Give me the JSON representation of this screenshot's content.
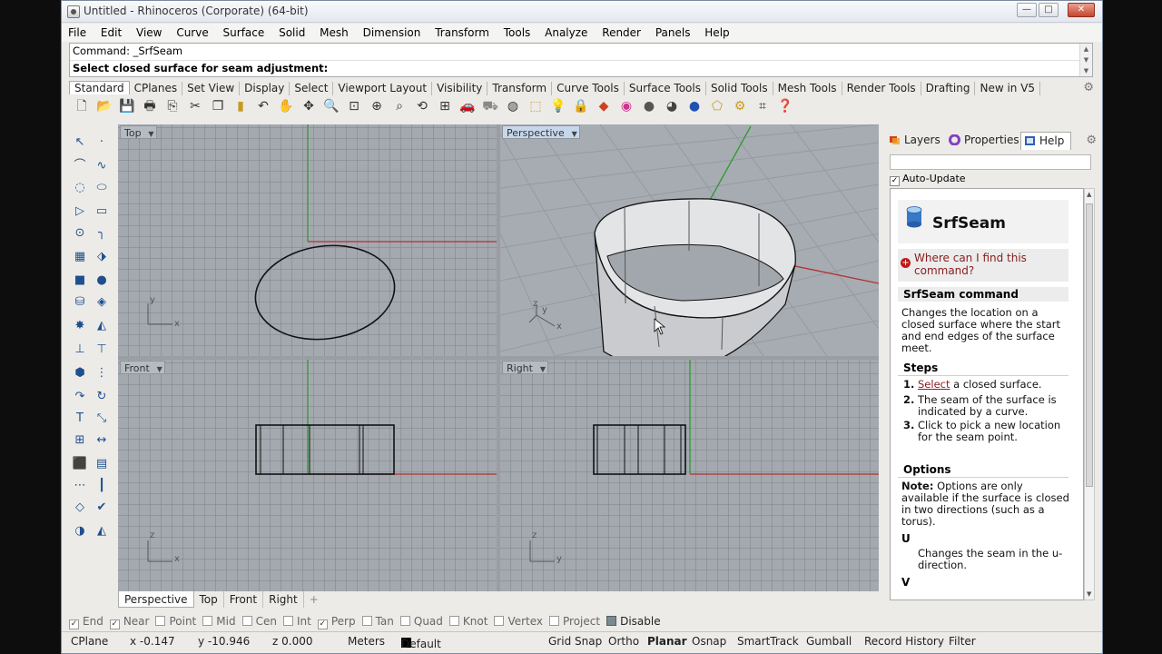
{
  "window": {
    "title": "Untitled - Rhinoceros (Corporate) (64-bit)",
    "min": "—",
    "max": "□",
    "close": "✕"
  },
  "menu": [
    "File",
    "Edit",
    "View",
    "Curve",
    "Surface",
    "Solid",
    "Mesh",
    "Dimension",
    "Transform",
    "Tools",
    "Analyze",
    "Render",
    "Panels",
    "Help"
  ],
  "command": {
    "line1": "Command: _SrfSeam",
    "line2": "Select closed surface for seam adjustment:"
  },
  "toolbar_tabs": [
    "Standard",
    "CPlanes",
    "Set View",
    "Display",
    "Select",
    "Viewport Layout",
    "Visibility",
    "Transform",
    "Curve Tools",
    "Surface Tools",
    "Solid Tools",
    "Mesh Tools",
    "Render Tools",
    "Drafting",
    "New in V5"
  ],
  "toolbar_icons": [
    "new-file-icon",
    "open-icon",
    "save-icon",
    "print-icon",
    "import-icon",
    "cut-icon",
    "copy-icon",
    "paste-icon",
    "undo-icon",
    "pan-icon",
    "rotate-icon",
    "zoom-icon",
    "zoom-window-icon",
    "zoom-extents-icon",
    "zoom-selected-icon",
    "rotate-view-icon",
    "viewport-layout-icon",
    "car-icon",
    "car-wire-icon",
    "hide-icon",
    "show-icon",
    "light-icon",
    "lock-icon",
    "layer-icon",
    "color-wheel-icon",
    "sphere-shaded-icon",
    "sphere-rendered-icon",
    "sphere-blue-icon",
    "select-filter-icon",
    "gear-icon",
    "grid-snap-icon",
    "help-icon"
  ],
  "viewports": [
    {
      "name": "Top",
      "axis1": "y",
      "axis2": "x"
    },
    {
      "name": "Perspective",
      "axis1": "z",
      "axis2": "y",
      "axis3": "x"
    },
    {
      "name": "Front",
      "axis1": "z",
      "axis2": "x"
    },
    {
      "name": "Right",
      "axis1": "z",
      "axis2": "y"
    }
  ],
  "viewport_tabs": [
    "Perspective",
    "Top",
    "Front",
    "Right",
    "+"
  ],
  "osnap": [
    {
      "label": "End",
      "checked": true
    },
    {
      "label": "Near",
      "checked": true
    },
    {
      "label": "Point",
      "checked": false
    },
    {
      "label": "Mid",
      "checked": false
    },
    {
      "label": "Cen",
      "checked": false
    },
    {
      "label": "Int",
      "checked": false
    },
    {
      "label": "Perp",
      "checked": true
    },
    {
      "label": "Tan",
      "checked": false
    },
    {
      "label": "Quad",
      "checked": false
    },
    {
      "label": "Knot",
      "checked": false
    },
    {
      "label": "Vertex",
      "checked": false
    },
    {
      "label": "Project",
      "checked": false
    },
    {
      "label": "Disable",
      "checked": false
    }
  ],
  "status": {
    "cplane": "CPlane",
    "x": "x -0.147",
    "y": "y -10.946",
    "z": "z 0.000",
    "units": "Meters",
    "layer": "Default",
    "grid_snap": "Grid Snap",
    "ortho": "Ortho",
    "planar": "Planar",
    "osnap": "Osnap",
    "smarttrack": "SmartTrack",
    "gumball": "Gumball",
    "record_history": "Record History",
    "filter": "Filter"
  },
  "panel": {
    "tabs": [
      "Layers",
      "Properties",
      "Help"
    ],
    "auto_update": "Auto-Update",
    "help": {
      "title": "SrfSeam",
      "where": "Where can I find this command?",
      "cmd_head": "SrfSeam command",
      "desc": "Changes the location on a closed surface where the start and end edges of the surface meet.",
      "steps_head": "Steps",
      "step1_link": "Select",
      "step1_rest": " a closed surface.",
      "step2": "The seam of the surface is indicated by a curve.",
      "step3": "Click to pick a new location for the seam point.",
      "options_head": "Options",
      "note_label": "Note:",
      "note_text": " Options are only available if the surface is closed in two directions (such as a torus).",
      "u_head": "U",
      "u_text": "Changes the seam in the u-direction.",
      "v_head": "V"
    }
  }
}
